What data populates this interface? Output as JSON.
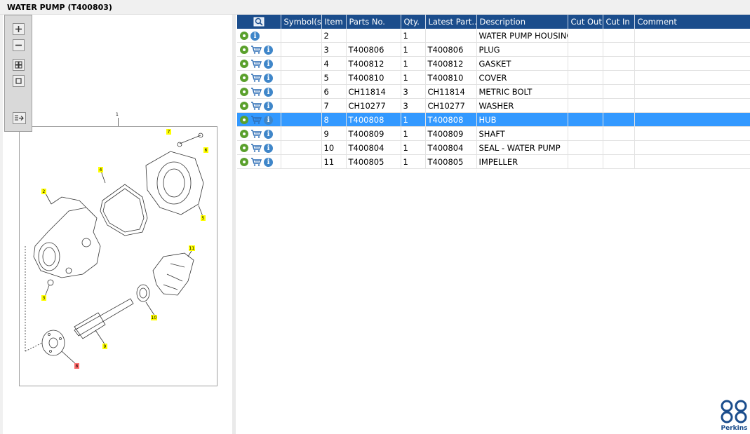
{
  "window": {
    "title": "WATER PUMP (T400803)"
  },
  "toolbar": {
    "buttons": [
      "zoom-in",
      "zoom-out",
      "fit-all",
      "actual-size",
      "export"
    ]
  },
  "diagram": {
    "top_label": "1",
    "callouts": [
      "7",
      "6",
      "4",
      "2",
      "5",
      "11",
      "3",
      "10",
      "9",
      "8"
    ]
  },
  "table": {
    "columns": [
      "Symbol(s)",
      "Item",
      "Parts No.",
      "Qty.",
      "Latest Part...",
      "Description",
      "Cut Out",
      "Cut In",
      "Comment"
    ],
    "rows": [
      {
        "item": "2",
        "part_no": "",
        "qty": "1",
        "latest": "",
        "description": "WATER PUMP HOUSING",
        "cart": false,
        "selected": false
      },
      {
        "item": "3",
        "part_no": "T400806",
        "qty": "1",
        "latest": "T400806",
        "description": "PLUG",
        "cart": true,
        "selected": false
      },
      {
        "item": "4",
        "part_no": "T400812",
        "qty": "1",
        "latest": "T400812",
        "description": "GASKET",
        "cart": true,
        "selected": false
      },
      {
        "item": "5",
        "part_no": "T400810",
        "qty": "1",
        "latest": "T400810",
        "description": "COVER",
        "cart": true,
        "selected": false
      },
      {
        "item": "6",
        "part_no": "CH11814",
        "qty": "3",
        "latest": "CH11814",
        "description": "METRIC BOLT",
        "cart": true,
        "selected": false
      },
      {
        "item": "7",
        "part_no": "CH10277",
        "qty": "3",
        "latest": "CH10277",
        "description": "WASHER",
        "cart": true,
        "selected": false
      },
      {
        "item": "8",
        "part_no": "T400808",
        "qty": "1",
        "latest": "T400808",
        "description": "HUB",
        "cart": true,
        "selected": true
      },
      {
        "item": "9",
        "part_no": "T400809",
        "qty": "1",
        "latest": "T400809",
        "description": "SHAFT",
        "cart": true,
        "selected": false
      },
      {
        "item": "10",
        "part_no": "T400804",
        "qty": "1",
        "latest": "T400804",
        "description": "SEAL - WATER PUMP",
        "cart": true,
        "selected": false
      },
      {
        "item": "11",
        "part_no": "T400805",
        "qty": "1",
        "latest": "T400805",
        "description": "IMPELLER",
        "cart": true,
        "selected": false
      }
    ]
  },
  "brand": {
    "name": "Perkins",
    "color": "#1b4d8c"
  },
  "colors": {
    "header": "#1b4d8c",
    "selection": "#3399ff",
    "callout_fill": "#ffff00",
    "callout_selected": "#ff6b6b"
  },
  "icons": {
    "row_gear": "gear-icon",
    "row_cart": "cart-icon",
    "row_info": "info-icon",
    "header_search": "search-icon"
  }
}
